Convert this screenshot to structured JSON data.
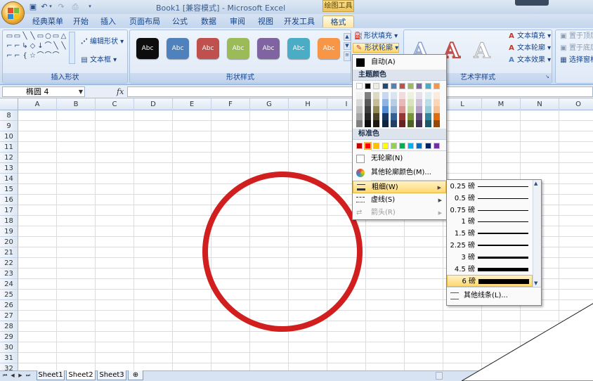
{
  "window": {
    "title_doc": "Book1",
    "title_mode": "[兼容模式]",
    "title_sep": " - ",
    "title_app": "Microsoft Excel",
    "context_tool": "绘图工具"
  },
  "tabs": [
    "经典菜单",
    "开始",
    "插入",
    "页面布局",
    "公式",
    "数据",
    "审阅",
    "视图",
    "开发工具",
    "格式"
  ],
  "ribbon": {
    "insert_shapes": {
      "label": "插入形状",
      "edit_shape": "编辑形状",
      "text_box": "文本框"
    },
    "shape_styles": {
      "label": "形状样式",
      "style_text": "Abc",
      "colors": [
        "#0d0d0d",
        "#4f81bd",
        "#c0504d",
        "#9bbb59",
        "#8064a2",
        "#4bacc6",
        "#f79646"
      ]
    },
    "shape_format": {
      "fill": "形状填充",
      "outline": "形状轮廓"
    },
    "wordart": {
      "label": "艺术字样式",
      "letter": "A",
      "text_fill": "文本填充",
      "text_outline": "文本轮廓",
      "text_effect": "文本效果"
    },
    "arrange": {
      "bring_front": "置于顶层",
      "send_back": "置于底层",
      "selection_pane": "选择窗格"
    }
  },
  "formula_bar": {
    "name_box": "椭圆 4",
    "fx": "fx",
    "value": ""
  },
  "columns": [
    "A",
    "B",
    "C",
    "D",
    "E",
    "F",
    "G",
    "H",
    "I",
    "J",
    "K",
    "L",
    "M",
    "N",
    "O"
  ],
  "rows": [
    "8",
    "9",
    "10",
    "11",
    "12",
    "13",
    "14",
    "15",
    "16",
    "17",
    "18",
    "19",
    "20",
    "21",
    "22",
    "23",
    "24",
    "25",
    "26",
    "27",
    "28",
    "29",
    "30",
    "31",
    "32",
    "33",
    "34"
  ],
  "sheets": [
    "Sheet1",
    "Sheet2",
    "Sheet3"
  ],
  "active_sheet": "Sheet2",
  "outline_menu": {
    "auto": "自动(A)",
    "theme_colors_label": "主题颜色",
    "theme_top": [
      "#ffffff",
      "#000000",
      "#eeece1",
      "#1f497d",
      "#4f81bd",
      "#c0504d",
      "#9bbb59",
      "#8064a2",
      "#4bacc6",
      "#f79646"
    ],
    "theme_shades": [
      [
        "#f2f2f2",
        "#7f7f7f",
        "#ddd9c3",
        "#c6d9f0",
        "#dbe5f1",
        "#f2dcdb",
        "#ebf1dd",
        "#e5e0ec",
        "#dbeef3",
        "#fdeada"
      ],
      [
        "#d8d8d8",
        "#595959",
        "#c4bd97",
        "#8db3e2",
        "#b8cce4",
        "#e5b9b7",
        "#d7e3bc",
        "#ccc1d9",
        "#b7dde8",
        "#fbd5b5"
      ],
      [
        "#bfbfbf",
        "#3f3f3f",
        "#938953",
        "#548dd4",
        "#95b3d7",
        "#d99694",
        "#c3d69b",
        "#b2a2c7",
        "#92cddc",
        "#fac08f"
      ],
      [
        "#a5a5a5",
        "#262626",
        "#494429",
        "#17365d",
        "#366092",
        "#953734",
        "#76923c",
        "#5f497a",
        "#31859b",
        "#e36c09"
      ],
      [
        "#7f7f7f",
        "#0c0c0c",
        "#1d1b10",
        "#0f243e",
        "#244061",
        "#632423",
        "#4f6128",
        "#3f3151",
        "#205867",
        "#974806"
      ]
    ],
    "standard_colors_label": "标准色",
    "standard": [
      "#c00000",
      "#ff0000",
      "#ffc000",
      "#ffff00",
      "#92d050",
      "#00b050",
      "#00b0f0",
      "#0070c0",
      "#002060",
      "#7030a0"
    ],
    "no_outline": "无轮廓(N)",
    "more_colors": "其他轮廓颜色(M)...",
    "weight": "粗细(W)",
    "dashes": "虚线(S)",
    "arrows": "箭头(R)"
  },
  "weight_menu": {
    "items": [
      {
        "label": "0.25 磅",
        "pt": 0.25
      },
      {
        "label": "0.5 磅",
        "pt": 0.5
      },
      {
        "label": "0.75 磅",
        "pt": 0.75
      },
      {
        "label": "1 磅",
        "pt": 1
      },
      {
        "label": "1.5 磅",
        "pt": 1.5
      },
      {
        "label": "2.25 磅",
        "pt": 2.25
      },
      {
        "label": "3 磅",
        "pt": 3
      },
      {
        "label": "4.5 磅",
        "pt": 4.5
      },
      {
        "label": "6 磅",
        "pt": 6
      }
    ],
    "selected": "6 磅",
    "more_lines": "其他线条(L)..."
  },
  "colors": {
    "circle_outline": "#d11e1e",
    "highlight": "#ffd76e"
  }
}
